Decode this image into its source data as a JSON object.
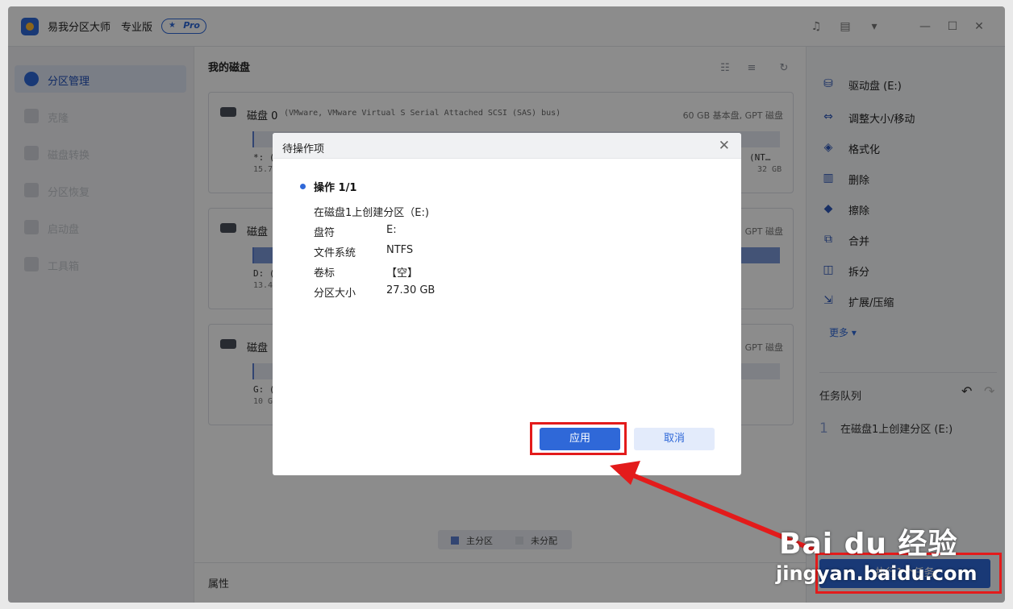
{
  "app": {
    "title": "易我分区大师",
    "edition": "专业版",
    "badge": "Pro"
  },
  "titlebar_icons": [
    "bell-icon",
    "notes-icon",
    "menu-box-icon",
    "minimize-icon",
    "maximize-icon",
    "close-icon"
  ],
  "sidebar": {
    "items": [
      {
        "label": "分区管理",
        "active": true
      },
      {
        "label": "克隆",
        "active": false
      },
      {
        "label": "磁盘转换",
        "active": false
      },
      {
        "label": "分区恢复",
        "active": false
      },
      {
        "label": "启动盘",
        "active": false
      },
      {
        "label": "工具箱",
        "active": false
      }
    ]
  },
  "center": {
    "title": "我的磁盘",
    "disks": [
      {
        "name": "磁盘 0",
        "desc": "(VMware,  VMware Virtual S Serial Attached SCSI (SAS) bus)",
        "info": "60 GB 基本盘, GPT 磁盘",
        "part_label": "*: (",
        "part_label_right": "(NT…",
        "part_size": "15.7",
        "part_size_right": "32 GB"
      },
      {
        "name": "磁盘",
        "info": "GPT 磁盘",
        "part_label": "D: (",
        "part_size": "13.4"
      },
      {
        "name": "磁盘",
        "info": "GPT 磁盘",
        "part_label": "G: (",
        "part_size": "10 G"
      }
    ],
    "legend": {
      "primary": "主分区",
      "unallocated": "未分配"
    },
    "properties": "属性"
  },
  "right": {
    "operations": [
      {
        "label": "驱动盘  (E:)",
        "icon": "drive-icon"
      },
      {
        "label": "调整大小/移动",
        "icon": "resize-icon"
      },
      {
        "label": "格式化",
        "icon": "format-icon"
      },
      {
        "label": "删除",
        "icon": "trash-icon"
      },
      {
        "label": "擦除",
        "icon": "eraser-icon"
      },
      {
        "label": "合并",
        "icon": "merge-icon"
      },
      {
        "label": "拆分",
        "icon": "split-icon"
      },
      {
        "label": "扩展/压缩",
        "icon": "extend-icon"
      }
    ],
    "more": "更多",
    "queue_title": "任务队列",
    "queue": [
      {
        "num": "1",
        "label": "在磁盘1上创建分区  (E:)"
      }
    ],
    "execute": "执行1个任务"
  },
  "dialog": {
    "title": "待操作项",
    "op_head": "操作 1/1",
    "op_desc": "在磁盘1上创建分区（E:)",
    "fields": [
      {
        "key": "盘符",
        "value": "E:"
      },
      {
        "key": "文件系统",
        "value": "NTFS"
      },
      {
        "key": "卷标",
        "value": "【空】"
      },
      {
        "key": "分区大小",
        "value": "27.30 GB"
      }
    ],
    "apply": "应用",
    "cancel": "取消"
  },
  "watermark": {
    "brand": "Bai du 经验",
    "url": "jingyan.baidu.com"
  },
  "colors": {
    "accent": "#2f68d8",
    "highlight": "#e31b1b"
  }
}
